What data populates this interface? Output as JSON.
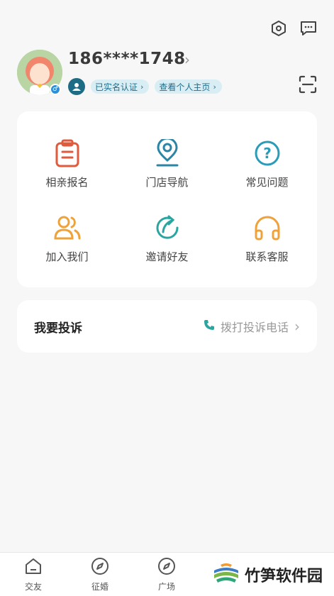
{
  "profile": {
    "phone": "186****1748",
    "verified_label": "已实名认证",
    "homepage_label": "查看个人主页"
  },
  "menu": [
    {
      "label": "相亲报名",
      "icon": "clipboard-icon",
      "color": "#e05a3c"
    },
    {
      "label": "门店导航",
      "icon": "location-pin-icon",
      "color": "#2b86a6"
    },
    {
      "label": "常见问题",
      "icon": "question-circle-icon",
      "color": "#2b9bb8"
    },
    {
      "label": "加入我们",
      "icon": "users-icon",
      "color": "#f0a23a"
    },
    {
      "label": "邀请好友",
      "icon": "share-arrow-icon",
      "color": "#2aa6a0"
    },
    {
      "label": "联系客服",
      "icon": "headphones-icon",
      "color": "#f0a23a"
    }
  ],
  "complaint": {
    "title": "我要投诉",
    "action": "拨打投诉电话"
  },
  "tabs": [
    {
      "label": "交友"
    },
    {
      "label": "征婚"
    },
    {
      "label": "广场"
    }
  ],
  "watermark": "竹笋软件园",
  "colors": {
    "accent": "#1e6b86",
    "pill_bg": "#d9eef4",
    "background": "#f7f7f7"
  }
}
